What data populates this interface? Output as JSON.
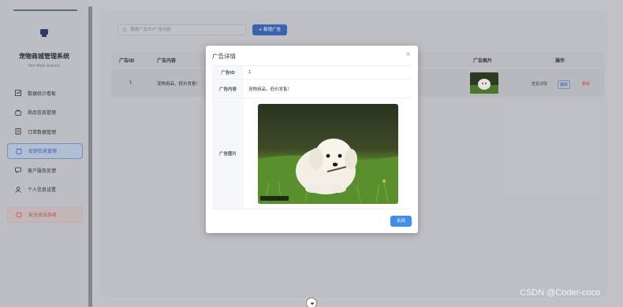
{
  "sidebar": {
    "title": "宠物商城管理系统",
    "subtitle": "Pet Mall Admin",
    "items": [
      {
        "label": "数据统计看板",
        "icon": "chart-icon"
      },
      {
        "label": "商品信息管理",
        "icon": "bag-icon"
      },
      {
        "label": "订单数据管理",
        "icon": "order-icon"
      },
      {
        "label": "促销信息管理",
        "icon": "promo-icon"
      },
      {
        "label": "客户服务反馈",
        "icon": "feedback-icon"
      },
      {
        "label": "个人信息设置",
        "icon": "user-icon"
      }
    ],
    "logout_label": "安全退出系统"
  },
  "toolbar": {
    "search_placeholder": "搜索广告ID/广告内容",
    "add_label": "+ 新增广告"
  },
  "table": {
    "headers": {
      "id": "广告ID",
      "content": "广告内容",
      "image": "广告图片",
      "ops": "操作"
    },
    "rows": [
      {
        "id": "1",
        "content": "宠物用品，低价发售！",
        "op_view": "查看详情",
        "op_edit": "编辑",
        "op_delete": "删除"
      }
    ]
  },
  "modal": {
    "title": "广告详情",
    "close_symbol": "×",
    "fields": [
      {
        "label": "广告ID",
        "value": "1"
      },
      {
        "label": "广告内容",
        "value": "宠物用品，低价发售！"
      }
    ],
    "image_label": "广告图片",
    "close_button": "关闭"
  },
  "watermark": "CSDN @Coder-coco",
  "colors": {
    "primary": "#3f8fe8",
    "active": "#3c63b8",
    "danger": "#c0504d"
  }
}
